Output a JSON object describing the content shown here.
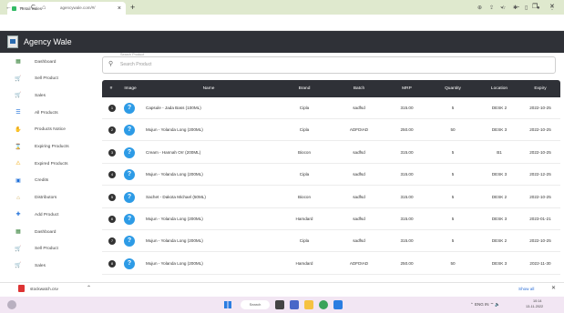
{
  "browser": {
    "tab_title": "Retail Sales",
    "new_tab": "+",
    "url": "agencywale.com/#/",
    "back": "←",
    "forward": "→",
    "reload": "C",
    "home": "⌂"
  },
  "app": {
    "name": "Agency Wale"
  },
  "sidebar": {
    "items": [
      {
        "label": "Dashboard",
        "icon": "dashboard-icon",
        "glyph": "▦",
        "color": "#2f7d32"
      },
      {
        "label": "Sell Product",
        "icon": "cart-icon",
        "glyph": "🛒",
        "color": "#2e8b57"
      },
      {
        "label": "Sales",
        "icon": "cart-icon",
        "glyph": "🛒",
        "color": "#2e8b57"
      },
      {
        "label": "All Products",
        "icon": "list-icon",
        "glyph": "☰",
        "color": "#1e6fd9"
      },
      {
        "label": "Products Notice",
        "icon": "hand-icon",
        "glyph": "✋",
        "color": "#e0a020"
      },
      {
        "label": "Expiring Products",
        "icon": "hourglass-icon",
        "glyph": "⌛",
        "color": "#3a9a3a"
      },
      {
        "label": "Expired Products",
        "icon": "warning-icon",
        "glyph": "⚠",
        "color": "#f0a500"
      },
      {
        "label": "Credits",
        "icon": "credit-icon",
        "glyph": "▣",
        "color": "#1e6fd9"
      },
      {
        "label": "Distributors",
        "icon": "distributor-icon",
        "glyph": "⌂",
        "color": "#c8a040"
      },
      {
        "label": "Add Product",
        "icon": "add-product-icon",
        "glyph": "✚",
        "color": "#1e6fd9"
      },
      {
        "label": "Dashboard",
        "icon": "dashboard-icon",
        "glyph": "▦",
        "color": "#2f7d32"
      },
      {
        "label": "Sell Product",
        "icon": "cart-icon",
        "glyph": "🛒",
        "color": "#2e8b57"
      },
      {
        "label": "Sales",
        "icon": "cart-icon",
        "glyph": "🛒",
        "color": "#2e8b57"
      }
    ]
  },
  "search": {
    "legend": "Search Product",
    "placeholder": "Search Product"
  },
  "table": {
    "headers": [
      "#",
      "Image",
      "Name",
      "Brand",
      "Batch",
      "MRP",
      "Quantity",
      "Location",
      "Expiry"
    ],
    "rows": [
      {
        "n": "1",
        "name": "Capsule - Jada Bass (100ML)",
        "brand": "Cipla",
        "batch": "sadfsd",
        "mrp": "315.00",
        "qty": "5",
        "loc": "DESK 2",
        "exp": "2022-10-25"
      },
      {
        "n": "2",
        "name": "Mujun - Yolanda Long (200ML)",
        "brand": "Cipla",
        "batch": "ADFDIAD",
        "mrp": "250.00",
        "qty": "50",
        "loc": "DESK 3",
        "exp": "2022-10-25"
      },
      {
        "n": "3",
        "name": "Cream - Hannah Orr (200ML)",
        "brand": "Biocon",
        "batch": "sadfsd",
        "mrp": "315.00",
        "qty": "5",
        "loc": "B1",
        "exp": "2022-10-25"
      },
      {
        "n": "4",
        "name": "Mujun - Yolanda Long (200ML)",
        "brand": "Cipla",
        "batch": "sadfsd",
        "mrp": "315.00",
        "qty": "5",
        "loc": "DESK 3",
        "exp": "2022-12-25"
      },
      {
        "n": "5",
        "name": "Sachet - Dakota Michael (50ML)",
        "brand": "Biocon",
        "batch": "sadfsd",
        "mrp": "315.00",
        "qty": "5",
        "loc": "DESK 2",
        "exp": "2022-10-25"
      },
      {
        "n": "6",
        "name": "Mujun - Yolanda Long (200ML)",
        "brand": "Hamdard",
        "batch": "sadfsd",
        "mrp": "315.00",
        "qty": "5",
        "loc": "DESK 3",
        "exp": "2023-01-21"
      },
      {
        "n": "7",
        "name": "Mujun - Yolanda Long (200ML)",
        "brand": "Cipla",
        "batch": "sadfsd",
        "mrp": "315.00",
        "qty": "5",
        "loc": "DESK 2",
        "exp": "2022-10-25"
      },
      {
        "n": "8",
        "name": "Mujun - Yolanda Long (200ML)",
        "brand": "Hamdard",
        "batch": "ADFDIAD",
        "mrp": "250.00",
        "qty": "50",
        "loc": "DESK 3",
        "exp": "2022-11-30"
      }
    ]
  },
  "downloads": {
    "file": "stockwatch.csv",
    "show_all": "Show all",
    "close": "✕"
  },
  "taskbar": {
    "search": "Search",
    "lang": "ENG IN",
    "time": "10:14",
    "date": "13-11-2022"
  },
  "colors": {
    "header_dark": "#2f3137",
    "accent_blue": "#2d9be6",
    "tab_strip": "#dfe9ce"
  }
}
